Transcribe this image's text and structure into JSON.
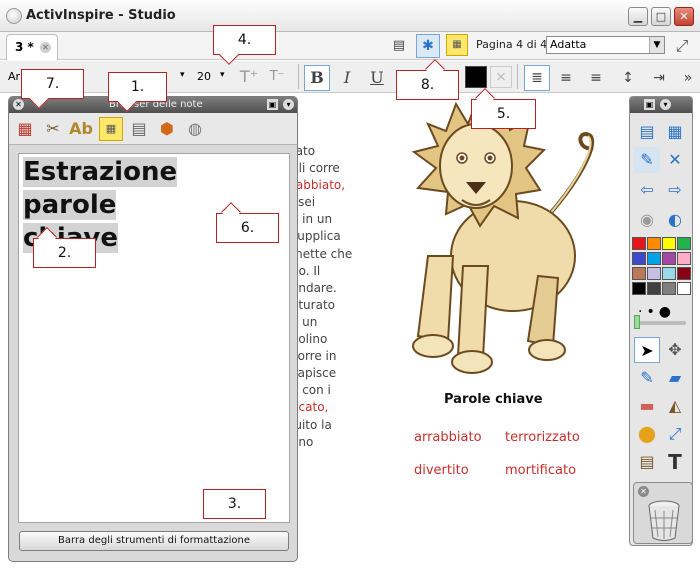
{
  "app": {
    "title": "ActivInspire - Studio"
  },
  "tab": {
    "label": "3 *"
  },
  "pager": {
    "info": "Pagina 4 di 4"
  },
  "zoom": {
    "value": "Adatta"
  },
  "format": {
    "font_name": "Ar",
    "font_size": "20"
  },
  "notes": {
    "header_title": "Browser delle note",
    "content": [
      "Estrazione parole",
      "chiave"
    ],
    "footer_button": "Barra degli strumenti di formattazione"
  },
  "story": {
    "lines": [
      {
        "text": "tato",
        "red": false
      },
      {
        "text": "gli corre",
        "red": false
      },
      {
        "text": "rabbiato,",
        "red": true
      },
      {
        "text": "i sei",
        "red": false
      },
      {
        "text": "o in un",
        "red": false
      },
      {
        "text": "supplica",
        "red": false
      },
      {
        "text": "mette che",
        "red": false
      },
      {
        "text": "no. Il",
        "red": false
      },
      {
        "text": "andare.",
        "red": false
      },
      {
        "text": "aturato",
        "red": false
      },
      {
        "text": "a un",
        "red": false
      },
      {
        "text": "oolino",
        "red": false
      },
      {
        "text": "corre in",
        "red": false
      },
      {
        "text": "capisce",
        "red": false
      },
      {
        "text": "e con i",
        "red": false
      },
      {
        "text": "ficato,",
        "red": true
      },
      {
        "text": "iuito la",
        "red": false
      },
      {
        "text": "ono",
        "red": false
      }
    ]
  },
  "flipchart": {
    "keywords_title": "Parole chiave",
    "keywords": [
      "arrabbiato",
      "terrorizzato",
      "divertito",
      "mortificato"
    ]
  },
  "callouts": [
    "1.",
    "2.",
    "3.",
    "4.",
    "5.",
    "6.",
    "7.",
    "8."
  ],
  "colors": {
    "accent_red": "#c4302b",
    "callout_border": "#b22222",
    "palette": [
      "#e8141c",
      "#ff8c00",
      "#ffff00",
      "#22b14c",
      "#3f48cc",
      "#00a2e8",
      "#a349a4",
      "#ffaec9",
      "#b97a57",
      "#c8bfe7",
      "#99d9ea",
      "#880015",
      "#000000",
      "#404040",
      "#7f7f7f",
      "#ffffff"
    ]
  },
  "icons": [
    "app-logo-icon",
    "minimize-icon",
    "maximize-icon",
    "close-icon",
    "page-icon",
    "desktop-annotate-icon",
    "note-icon",
    "fullscreen-icon",
    "bold-icon",
    "italic-icon",
    "underline-icon",
    "align-left-icon",
    "align-center-icon",
    "align-right-icon",
    "line-spacing-icon",
    "indent-icon",
    "more-icon",
    "pin-icon",
    "trash-icon"
  ]
}
